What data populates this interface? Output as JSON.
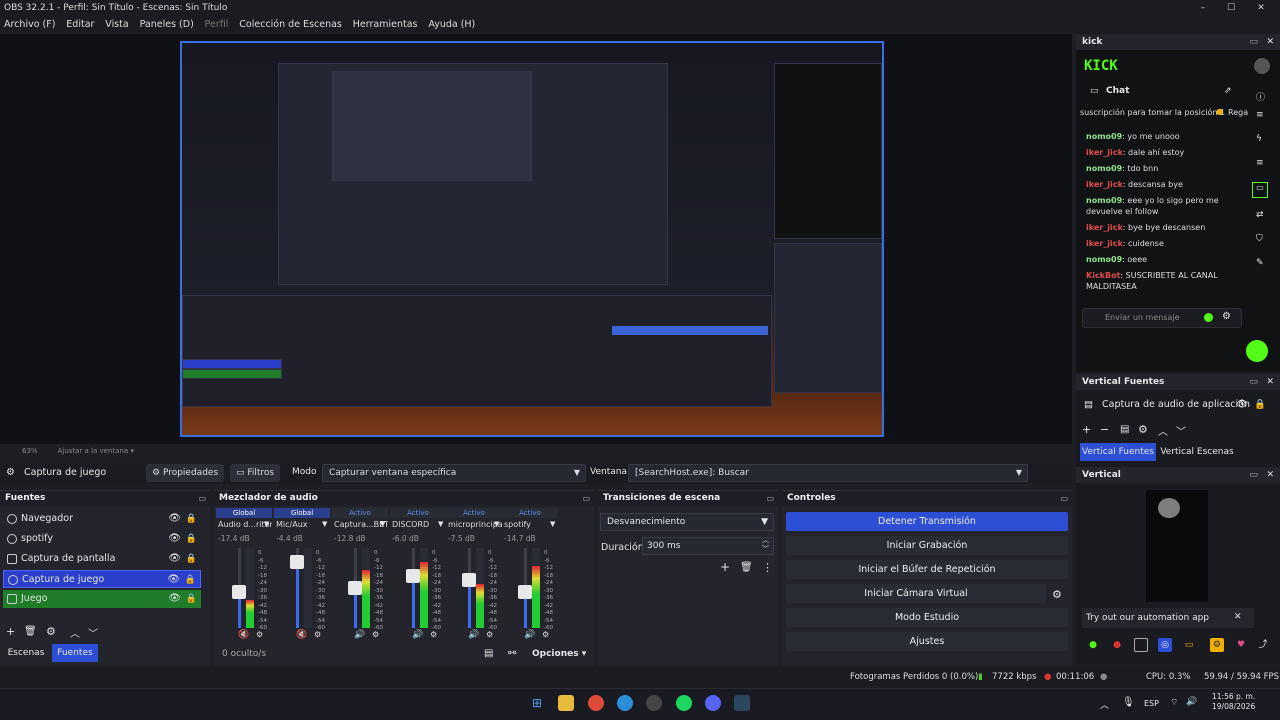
{
  "window": {
    "title": "OBS 32.2.1 - Perfil: Sin Título - Escenas: Sin Título"
  },
  "menu": [
    "Archivo (F)",
    "Editar",
    "Vista",
    "Paneles (D)",
    "Perfil",
    "Colección de Escenas",
    "Herramientas",
    "Ayuda (H)"
  ],
  "preview_footer": {
    "zoom": "63%",
    "fit": "Ajustar a la ventana"
  },
  "source_toolbar": {
    "source_name": "Captura de juego",
    "properties": "Propiedades",
    "filters": "Filtros",
    "mode_label": "Modo",
    "mode_value": "Capturar ventana específica",
    "window_label": "Ventana",
    "window_value": "[SearchHost.exe]: Buscar"
  },
  "sources": {
    "title": "Fuentes",
    "items": [
      {
        "label": "Navegador"
      },
      {
        "label": "spotify"
      },
      {
        "label": "Captura de pantalla"
      },
      {
        "label": "Captura de juego"
      },
      {
        "label": "Juego"
      }
    ],
    "tab_scenes": "Escenas",
    "tab_sources": "Fuentes"
  },
  "mixer": {
    "title": "Mezclador de audio",
    "channels": [
      {
        "tag": "Global",
        "name": "Audio d...ritorio",
        "db": "-17.4 dB",
        "level": 0.35,
        "volume": 0.45
      },
      {
        "tag": "Global",
        "name": "Mic/Aux",
        "db": "-4.4 dB",
        "level": 0.0,
        "volume": 0.82
      },
      {
        "tag": "Activo",
        "name": "Captura...BETA) 2",
        "db": "-12.8 dB",
        "level": 0.72,
        "volume": 0.5
      },
      {
        "tag": "Activo",
        "name": "DISCORD",
        "db": "-6.0 dB",
        "level": 0.82,
        "volume": 0.65
      },
      {
        "tag": "Activo",
        "name": "microprincipal",
        "db": "-7.5 dB",
        "level": 0.55,
        "volume": 0.6
      },
      {
        "tag": "Activo",
        "name": "spotify",
        "db": "-14.7 dB",
        "level": 0.78,
        "volume": 0.45
      }
    ],
    "scale": [
      "0",
      "-6",
      "-12",
      "-18",
      "-24",
      "-30",
      "-36",
      "-42",
      "-48",
      "-54",
      "-60"
    ],
    "hidden": "0 oculto/s",
    "options": "Opciones"
  },
  "transitions": {
    "title": "Transiciones de escena",
    "type": "Desvanecimiento",
    "duration_label": "Duración",
    "duration_value": "300 ms"
  },
  "controls": {
    "title": "Controles",
    "buttons": [
      "Detener Transmisión",
      "Iniciar Grabación",
      "Iniciar el Búfer de Repetición",
      "Iniciar Cámara Virtual",
      "Modo Estudio",
      "Ajustes"
    ]
  },
  "kick": {
    "title": "kick",
    "logo": "KICK",
    "chat_title": "Chat",
    "pinned": "suscripción para tomar la posición 1",
    "pinned_right": "Rega",
    "messages": [
      {
        "user": "nomo09",
        "text": "yo me unooo",
        "color": "green"
      },
      {
        "user": "iker_jick",
        "text": "dale ahí estoy",
        "color": "red"
      },
      {
        "user": "nomo09",
        "text": "tdo bnn",
        "color": "green"
      },
      {
        "user": "iker_jick",
        "text": "descansa bye",
        "color": "red"
      },
      {
        "user": "nomo09",
        "text": "eee yo lo sigo pero me devuelve el follow",
        "color": "green"
      },
      {
        "user": "iker_jick",
        "text": "bye bye descansen",
        "color": "red"
      },
      {
        "user": "iker_jick",
        "text": "cuidense",
        "color": "red"
      },
      {
        "user": "nomo09",
        "text": "oeee",
        "color": "green"
      },
      {
        "user": "KickBot",
        "text": "SUSCRIBETE AL CANAL MALDITASEA",
        "color": "red"
      }
    ],
    "input_placeholder": "Enviar un mensaje"
  },
  "vertical_sources": {
    "title": "Vertical Fuentes",
    "item": "Captura de audio de aplicación",
    "tab1": "Vertical Fuentes",
    "tab2": "Vertical Escenas"
  },
  "vertical": {
    "title": "Vertical",
    "automation": "Try out our automation app"
  },
  "status": {
    "dropped": "Fotogramas Perdidos 0 (0.0%)",
    "kbps": "7722 kbps",
    "time": "00:11:06",
    "cpu": "CPU: 0.3%",
    "fps": "59.94 / 59.94 FPS"
  },
  "taskbar": {
    "lang": "ESP",
    "time": "11:56 p. m.",
    "date": "19/08/2026"
  },
  "colors": {
    "accent": "#2d4fd6",
    "kick_green": "#53fc18"
  }
}
